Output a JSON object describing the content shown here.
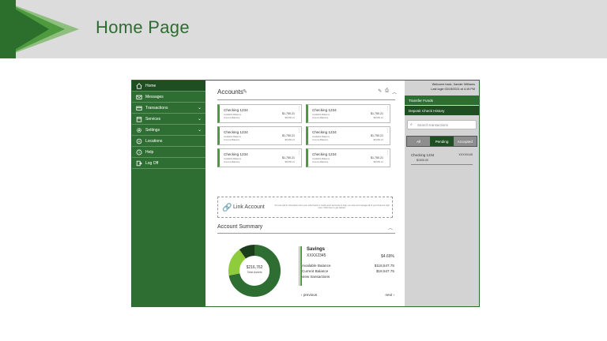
{
  "slide": {
    "title": "Home Page"
  },
  "colors": {
    "brand_dark": "#1f4e23",
    "brand": "#2f6e33",
    "accent": "#4e9a3f",
    "light_accent": "#8fcc3b",
    "panel": "#d3d3d3"
  },
  "sidebar": {
    "items": [
      {
        "label": "Home",
        "icon": "home-icon",
        "chevron": false
      },
      {
        "label": "Messages",
        "icon": "mail-icon",
        "chevron": false
      },
      {
        "label": "Transactions",
        "icon": "card-icon",
        "chevron": true
      },
      {
        "label": "Services",
        "icon": "calendar-icon",
        "chevron": true
      },
      {
        "label": "Settings",
        "icon": "gear-icon",
        "chevron": true
      },
      {
        "label": "Locations",
        "icon": "location-icon",
        "chevron": false
      },
      {
        "label": "Help",
        "icon": "help-icon",
        "chevron": false
      },
      {
        "label": "Log Off",
        "icon": "logout-icon",
        "chevron": false
      }
    ]
  },
  "accounts": {
    "title": "Accounts",
    "cards": [
      {
        "name": "Checking 1234",
        "available_label": "Available Balance",
        "current_label": "Current Balance",
        "available": "$1,750.21",
        "current": "$8,650.21"
      },
      {
        "name": "Checking 1234",
        "available_label": "Available Balance",
        "current_label": "Current Balance",
        "available": "$1,750.21",
        "current": "$8,650.21"
      },
      {
        "name": "Checking 1234",
        "available_label": "Available Balance",
        "current_label": "Current Balance",
        "available": "$1,750.21",
        "current": "$8,650.21"
      },
      {
        "name": "Checking 1234",
        "available_label": "Available Balance",
        "current_label": "Current Balance",
        "available": "$1,750.21",
        "current": "$8,650.21"
      },
      {
        "name": "Checking 1234",
        "available_label": "Available Balance",
        "current_label": "Current Balance",
        "available": "$1,750.21",
        "current": "$8,650.21"
      },
      {
        "name": "Checking 1234",
        "available_label": "Available Balance",
        "current_label": "Current Balance",
        "available": "$1,750.21",
        "current": "$8,650.21"
      }
    ]
  },
  "link_account": {
    "label": "Link Account",
    "description": "You can pull in information from your other bank or credit union accounts to help you view and manage all of your finances right here. Click here to get started."
  },
  "summary": {
    "title": "Account Summary",
    "total": "$216,762",
    "total_label": "Total Assets",
    "account_name": "Savings",
    "account_number": "XXXX2345",
    "rate": "$4.69%",
    "available_label": "Available Balance",
    "available": "$118,547.75",
    "current_label": "Current Balance",
    "current": "$18,547.75",
    "view_link": "view transactions",
    "previous": "previous",
    "next": "next",
    "donut": [
      {
        "value": 0.72,
        "color": "#2f6e33"
      },
      {
        "value": 0.18,
        "color": "#8fcc3b"
      },
      {
        "value": 0.1,
        "color": "#1a3d1c"
      }
    ]
  },
  "right_panel": {
    "welcome": "Welcome back, Xander Williams",
    "last_login": "Last login 03/15/2021 at 4:15 PM",
    "transfer": "Transfer Funds",
    "deposit": "Deposit Check History",
    "search_placeholder": "Search transactions",
    "tabs": [
      "All",
      "Pending",
      "Accepted"
    ],
    "selected_tab": "Pending",
    "transaction": {
      "name": "Checking 1234",
      "number": "XXXX0145",
      "amount": "$1000.00"
    }
  }
}
